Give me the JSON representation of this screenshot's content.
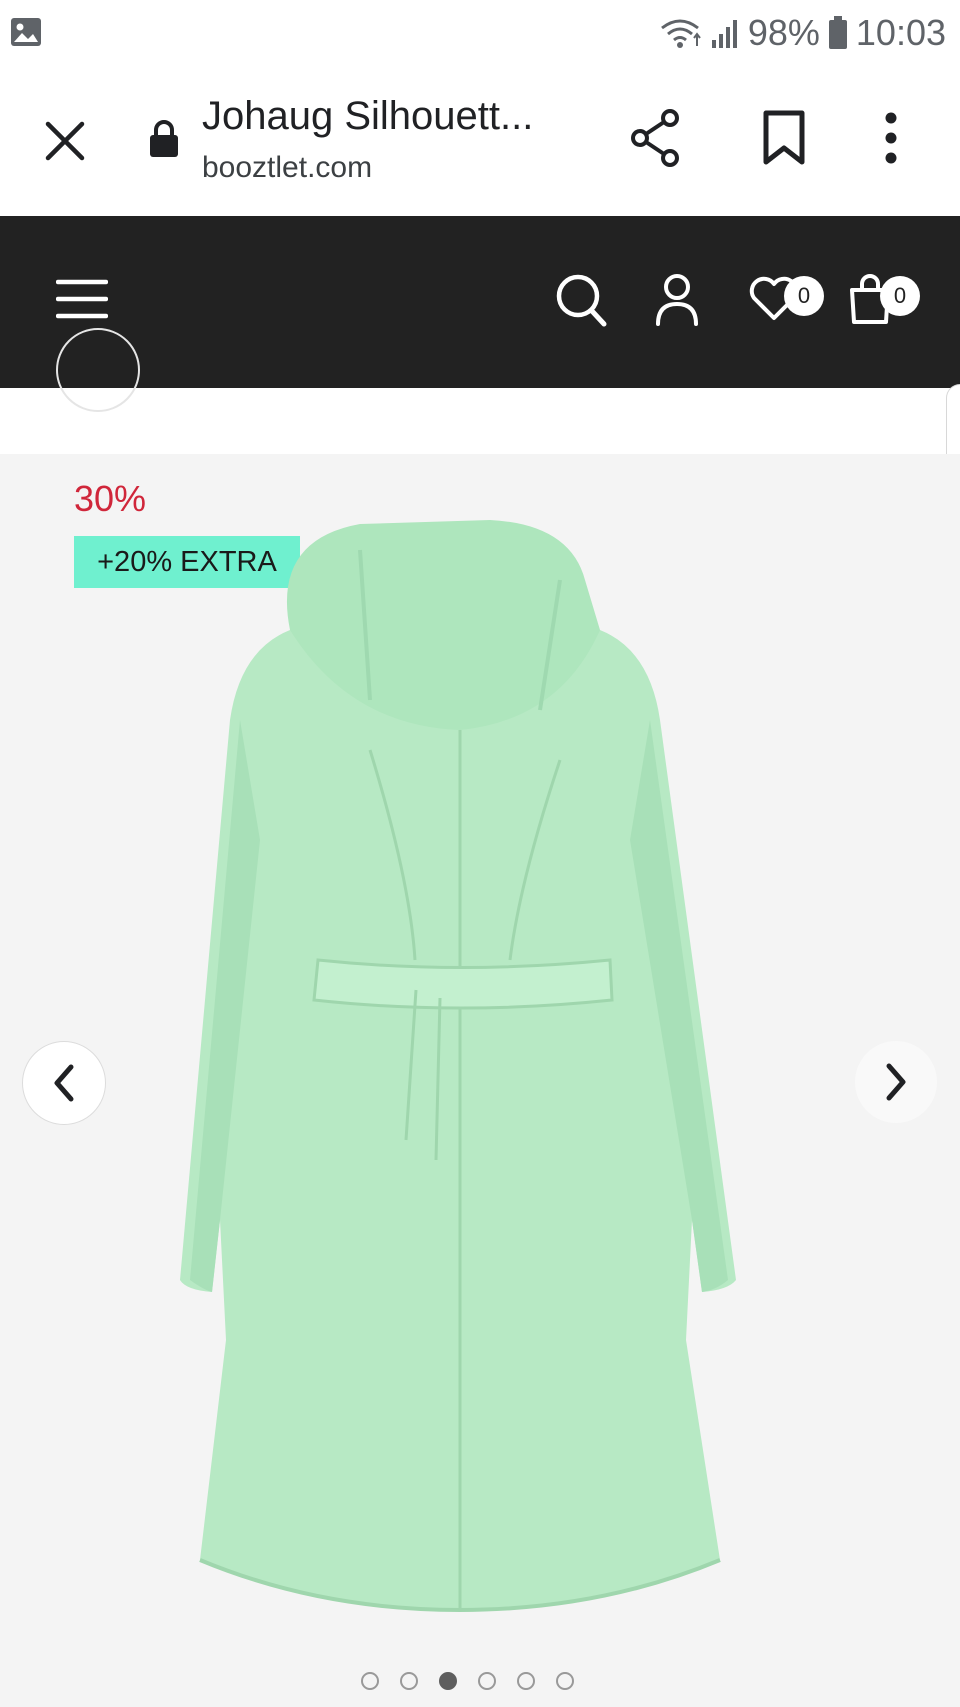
{
  "statusbar": {
    "battery": "98%",
    "time": "10:03",
    "icons": [
      "gallery-icon",
      "wifi-icon",
      "signal-icon",
      "battery-icon"
    ]
  },
  "browser": {
    "title": "Johaug Silhouett...",
    "domain": "booztlet.com",
    "icons": [
      "close-icon",
      "lock-icon",
      "share-icon",
      "bookmark-icon",
      "more-vert-icon"
    ]
  },
  "site_header": {
    "background": "#222222",
    "wishlist_count": "0",
    "cart_count": "0",
    "icons": [
      "menu-icon",
      "search-icon",
      "account-icon",
      "heart-icon",
      "shopping-bag-icon"
    ]
  },
  "product": {
    "discount_label": "30%",
    "extra_badge": "+20% EXTRA",
    "discount_color": "#d0263a",
    "badge_color": "#6ff0cf",
    "coat_color": "#b7e9c4"
  },
  "carousel": {
    "slide_count": 6,
    "active_index": 2
  }
}
